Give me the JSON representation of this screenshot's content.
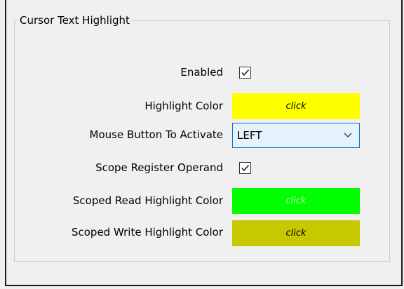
{
  "group": {
    "title": "Cursor Text Highlight"
  },
  "rows": {
    "enabled": {
      "label": "Enabled",
      "checked": true
    },
    "highlight_color": {
      "label": "Highlight Color",
      "button_text": "click",
      "color": "#ffff00",
      "text_color": "#000000"
    },
    "mouse_button": {
      "label": "Mouse Button To Activate",
      "value": "LEFT"
    },
    "scope_register": {
      "label": "Scope Register Operand",
      "checked": true
    },
    "scoped_read": {
      "label": "Scoped Read Highlight Color",
      "button_text": "click",
      "color": "#00ff00",
      "text_color": "#b7f5a5"
    },
    "scoped_write": {
      "label": "Scoped Write Highlight Color",
      "button_text": "click",
      "color": "#c8c800",
      "text_color": "#000000"
    }
  },
  "icons": {
    "checkbox": "check-icon",
    "dropdown": "chevron-down-icon"
  }
}
